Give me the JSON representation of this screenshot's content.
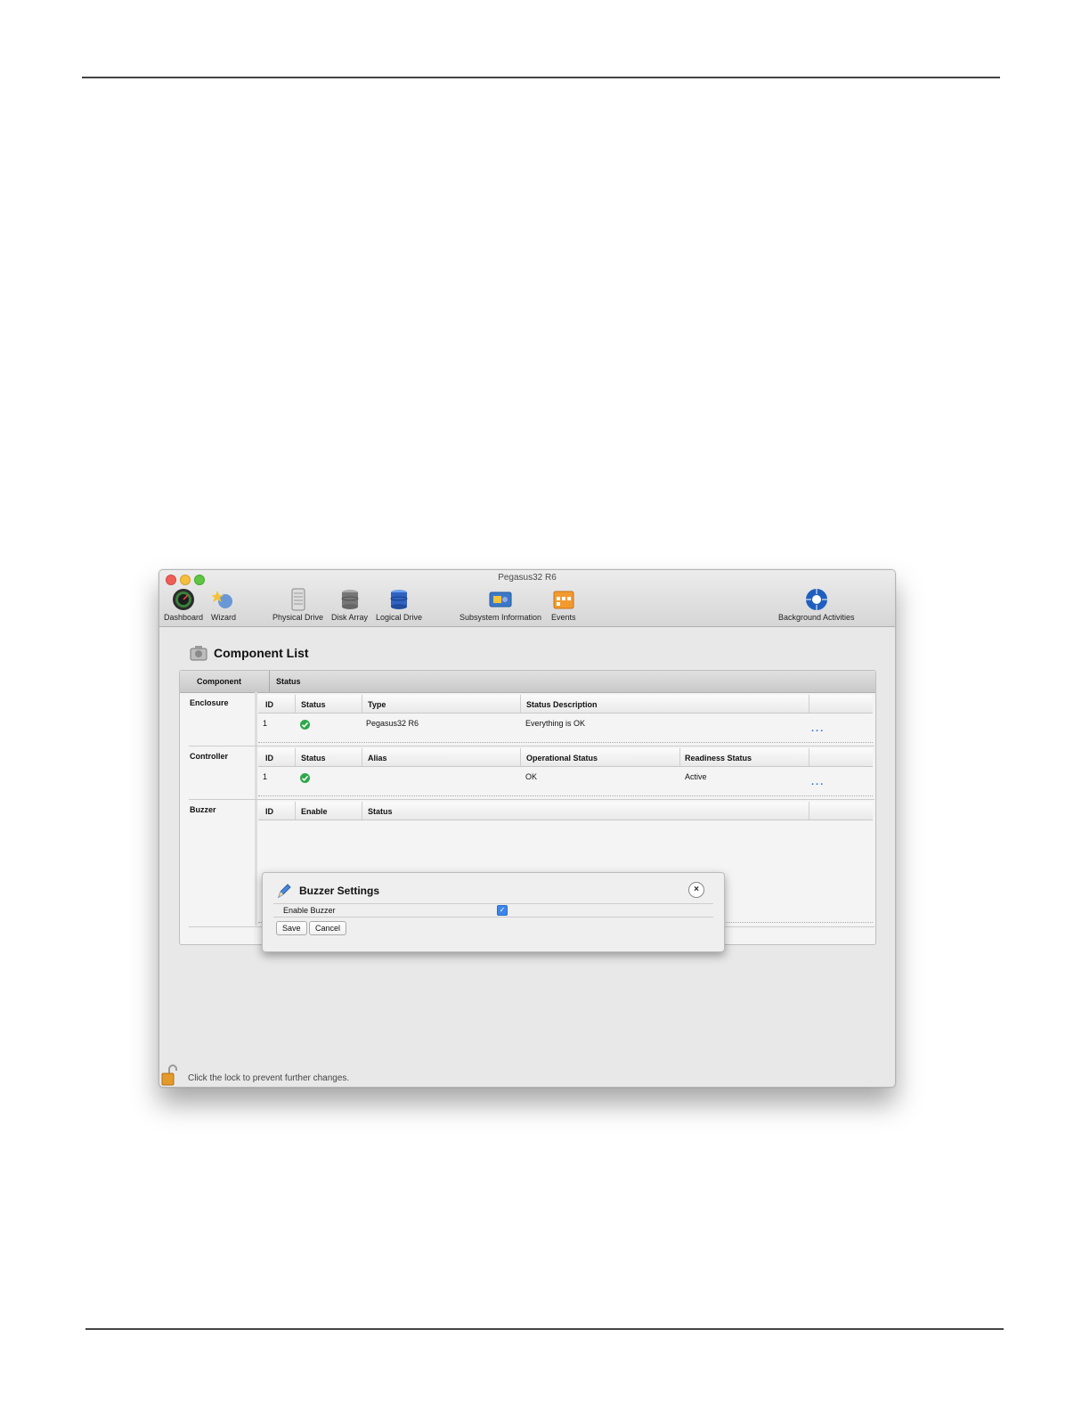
{
  "window": {
    "title": "Pegasus32 R6"
  },
  "toolbar": {
    "dashboard": "Dashboard",
    "wizard": "Wizard",
    "physical_drive": "Physical Drive",
    "disk_array": "Disk Array",
    "logical_drive": "Logical Drive",
    "subsystem_information": "Subsystem Information",
    "events": "Events",
    "background_activities": "Background Activities"
  },
  "page": {
    "title": "Component List"
  },
  "panel": {
    "headers": {
      "component": "Component",
      "status": "Status"
    },
    "enclosure": {
      "label": "Enclosure",
      "columns": [
        "ID",
        "Status",
        "Type",
        "Status Description"
      ],
      "row": {
        "id": "1",
        "status": "ok",
        "type": "Pegasus32 R6",
        "description": "Everything is OK"
      },
      "more": "..."
    },
    "controller": {
      "label": "Controller",
      "columns": [
        "ID",
        "Status",
        "Alias",
        "Operational Status",
        "Readiness Status"
      ],
      "row": {
        "id": "1",
        "status": "ok",
        "alias": "",
        "operational": "OK",
        "readiness": "Active"
      },
      "more": "..."
    },
    "buzzer": {
      "label": "Buzzer",
      "columns": [
        "ID",
        "Enable",
        "Status"
      ]
    }
  },
  "dialog": {
    "title": "Buzzer Settings",
    "field_label": "Enable Buzzer",
    "enabled": true,
    "save": "Save",
    "cancel": "Cancel"
  },
  "footer": {
    "text": "Click the lock to prevent further changes."
  },
  "colors": {
    "ok": "#2da84a",
    "link": "#2a74d6",
    "checkbox": "#3b86e8"
  }
}
